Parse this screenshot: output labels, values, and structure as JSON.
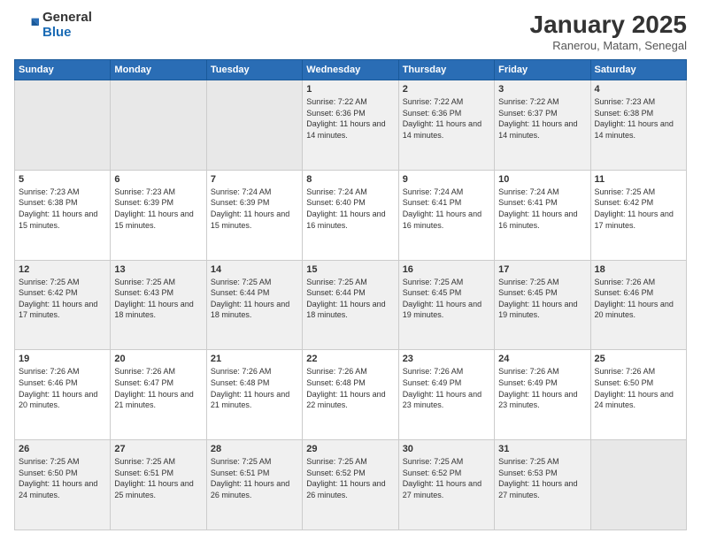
{
  "logo": {
    "general": "General",
    "blue": "Blue"
  },
  "header": {
    "month": "January 2025",
    "location": "Ranerou, Matam, Senegal"
  },
  "weekdays": [
    "Sunday",
    "Monday",
    "Tuesday",
    "Wednesday",
    "Thursday",
    "Friday",
    "Saturday"
  ],
  "weeks": [
    [
      {
        "day": "",
        "info": ""
      },
      {
        "day": "",
        "info": ""
      },
      {
        "day": "",
        "info": ""
      },
      {
        "day": "1",
        "info": "Sunrise: 7:22 AM\nSunset: 6:36 PM\nDaylight: 11 hours and 14 minutes."
      },
      {
        "day": "2",
        "info": "Sunrise: 7:22 AM\nSunset: 6:36 PM\nDaylight: 11 hours and 14 minutes."
      },
      {
        "day": "3",
        "info": "Sunrise: 7:22 AM\nSunset: 6:37 PM\nDaylight: 11 hours and 14 minutes."
      },
      {
        "day": "4",
        "info": "Sunrise: 7:23 AM\nSunset: 6:38 PM\nDaylight: 11 hours and 14 minutes."
      }
    ],
    [
      {
        "day": "5",
        "info": "Sunrise: 7:23 AM\nSunset: 6:38 PM\nDaylight: 11 hours and 15 minutes."
      },
      {
        "day": "6",
        "info": "Sunrise: 7:23 AM\nSunset: 6:39 PM\nDaylight: 11 hours and 15 minutes."
      },
      {
        "day": "7",
        "info": "Sunrise: 7:24 AM\nSunset: 6:39 PM\nDaylight: 11 hours and 15 minutes."
      },
      {
        "day": "8",
        "info": "Sunrise: 7:24 AM\nSunset: 6:40 PM\nDaylight: 11 hours and 16 minutes."
      },
      {
        "day": "9",
        "info": "Sunrise: 7:24 AM\nSunset: 6:41 PM\nDaylight: 11 hours and 16 minutes."
      },
      {
        "day": "10",
        "info": "Sunrise: 7:24 AM\nSunset: 6:41 PM\nDaylight: 11 hours and 16 minutes."
      },
      {
        "day": "11",
        "info": "Sunrise: 7:25 AM\nSunset: 6:42 PM\nDaylight: 11 hours and 17 minutes."
      }
    ],
    [
      {
        "day": "12",
        "info": "Sunrise: 7:25 AM\nSunset: 6:42 PM\nDaylight: 11 hours and 17 minutes."
      },
      {
        "day": "13",
        "info": "Sunrise: 7:25 AM\nSunset: 6:43 PM\nDaylight: 11 hours and 18 minutes."
      },
      {
        "day": "14",
        "info": "Sunrise: 7:25 AM\nSunset: 6:44 PM\nDaylight: 11 hours and 18 minutes."
      },
      {
        "day": "15",
        "info": "Sunrise: 7:25 AM\nSunset: 6:44 PM\nDaylight: 11 hours and 18 minutes."
      },
      {
        "day": "16",
        "info": "Sunrise: 7:25 AM\nSunset: 6:45 PM\nDaylight: 11 hours and 19 minutes."
      },
      {
        "day": "17",
        "info": "Sunrise: 7:25 AM\nSunset: 6:45 PM\nDaylight: 11 hours and 19 minutes."
      },
      {
        "day": "18",
        "info": "Sunrise: 7:26 AM\nSunset: 6:46 PM\nDaylight: 11 hours and 20 minutes."
      }
    ],
    [
      {
        "day": "19",
        "info": "Sunrise: 7:26 AM\nSunset: 6:46 PM\nDaylight: 11 hours and 20 minutes."
      },
      {
        "day": "20",
        "info": "Sunrise: 7:26 AM\nSunset: 6:47 PM\nDaylight: 11 hours and 21 minutes."
      },
      {
        "day": "21",
        "info": "Sunrise: 7:26 AM\nSunset: 6:48 PM\nDaylight: 11 hours and 21 minutes."
      },
      {
        "day": "22",
        "info": "Sunrise: 7:26 AM\nSunset: 6:48 PM\nDaylight: 11 hours and 22 minutes."
      },
      {
        "day": "23",
        "info": "Sunrise: 7:26 AM\nSunset: 6:49 PM\nDaylight: 11 hours and 23 minutes."
      },
      {
        "day": "24",
        "info": "Sunrise: 7:26 AM\nSunset: 6:49 PM\nDaylight: 11 hours and 23 minutes."
      },
      {
        "day": "25",
        "info": "Sunrise: 7:26 AM\nSunset: 6:50 PM\nDaylight: 11 hours and 24 minutes."
      }
    ],
    [
      {
        "day": "26",
        "info": "Sunrise: 7:25 AM\nSunset: 6:50 PM\nDaylight: 11 hours and 24 minutes."
      },
      {
        "day": "27",
        "info": "Sunrise: 7:25 AM\nSunset: 6:51 PM\nDaylight: 11 hours and 25 minutes."
      },
      {
        "day": "28",
        "info": "Sunrise: 7:25 AM\nSunset: 6:51 PM\nDaylight: 11 hours and 26 minutes."
      },
      {
        "day": "29",
        "info": "Sunrise: 7:25 AM\nSunset: 6:52 PM\nDaylight: 11 hours and 26 minutes."
      },
      {
        "day": "30",
        "info": "Sunrise: 7:25 AM\nSunset: 6:52 PM\nDaylight: 11 hours and 27 minutes."
      },
      {
        "day": "31",
        "info": "Sunrise: 7:25 AM\nSunset: 6:53 PM\nDaylight: 11 hours and 27 minutes."
      },
      {
        "day": "",
        "info": ""
      }
    ]
  ]
}
